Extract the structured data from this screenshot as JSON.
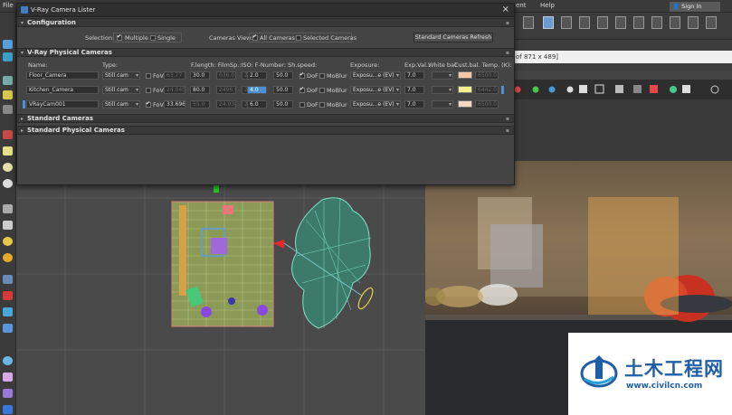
{
  "menubar": {
    "items": [
      "File",
      "ent",
      "Help"
    ],
    "signin_label": "Sign In"
  },
  "viewport_right": {
    "size_field": "of 871 x 489]"
  },
  "dialog": {
    "title": "V-Ray Camera Lister",
    "close_label": "×",
    "configuration": {
      "header": "Configuration",
      "selection_label": "Selection:",
      "multiple_label": "Multiple",
      "single_label": "Single",
      "cameras_view_label": "Cameras View:",
      "all_cameras_label": "All Cameras",
      "selected_cameras_label": "Selected Cameras",
      "refresh_button": "Standard Cameras Refresh"
    },
    "vray_physical": {
      "header": "V-Ray Physical Cameras",
      "columns": {
        "name": "Name:",
        "type": "Type:",
        "flength": "F.length: FilmSp.:ISO: F-Number: Sh.speed:",
        "exposure": "Exposure:",
        "exp_val": "Exp.Val.:",
        "white_bal": "White bal:",
        "cust_temp": "Cust.bal. Temp. (K):"
      },
      "rows": [
        {
          "name": "Floor_Camera",
          "type": "Still cam",
          "fov_label": "FoV",
          "fov": "63.77",
          "flength": "30.0",
          "filmsp": "036.0",
          "iso": "200.0",
          "fnumber": "2.0",
          "shspeed": "50.0",
          "dof_label": "DoF",
          "motionblur_label": "MoBlur",
          "exposure": "Exposu...e (EV)",
          "exp_val": "7.0",
          "white_bal": "",
          "temp": "6500.0",
          "fov_on": false,
          "dof_on": true,
          "mb_on": false,
          "swatch": "#f4c9a8"
        },
        {
          "name": "Kitchen_Camera",
          "type": "Still cam",
          "fov_label": "FoV",
          "fov": "24.040",
          "flength": "80.0",
          "filmsp": "2496.0",
          "iso": "200.0",
          "fnumber": "4.0",
          "shspeed": "50.0",
          "dof_label": "DoF",
          "motionblur_label": "MoBlur",
          "exposure": "Exposu...e (EV)",
          "exp_val": "7.0",
          "white_bal": "",
          "temp": "6442.0",
          "fov_on": false,
          "dof_on": true,
          "mb_on": false,
          "swatch": "#f4f18a"
        },
        {
          "name": "VRayCam001",
          "type": "Still cam",
          "fov_label": "FoV",
          "fov": "33.696",
          "flength": "55.0",
          "filmsp": "24.934",
          "iso": "200.0",
          "fnumber": "6.0",
          "shspeed": "50.0",
          "dof_label": "DoF",
          "motionblur_label": "MoBlur",
          "exposure": "Exposu...e (EV)",
          "exp_val": "7.0",
          "white_bal": "",
          "temp": "6500.0",
          "fov_on": true,
          "dof_on": false,
          "mb_on": false,
          "swatch": "#f2d9c2"
        }
      ]
    },
    "standard_cameras_header": "Standard Cameras",
    "standard_physical_header": "Standard Physical Cameras"
  },
  "watermark": {
    "title": "土木工程网",
    "url": "www.civilcn.com"
  }
}
